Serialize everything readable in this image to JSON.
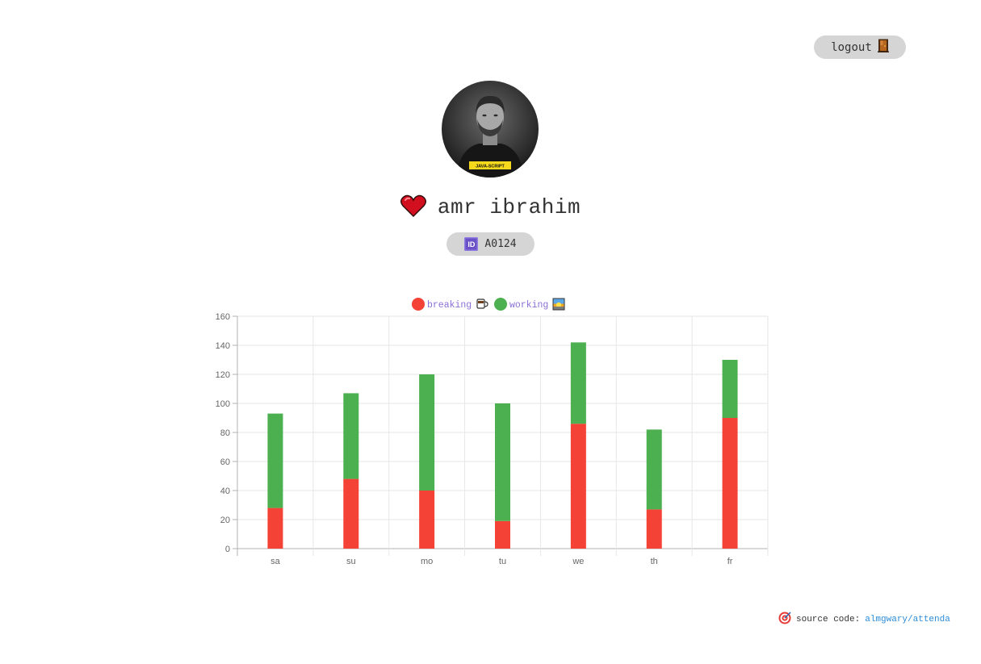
{
  "header": {
    "logout_label": "logout",
    "logout_icon": "door-icon"
  },
  "profile": {
    "name": "amr ibrahim",
    "heart_icon": "heart-icon",
    "id_badge_icon": "id-icon",
    "id_icon_text": "ID",
    "employee_id": "A0124",
    "avatar_shirt_text": "JAVA-SCRIPT"
  },
  "chart_data": {
    "type": "bar",
    "stacked": true,
    "categories": [
      "sa",
      "su",
      "mo",
      "tu",
      "we",
      "th",
      "fr"
    ],
    "series": [
      {
        "name": "breaking",
        "icon": "coffee-icon",
        "color": "#f44336",
        "values": [
          28,
          48,
          40,
          19,
          86,
          27,
          90
        ]
      },
      {
        "name": "working",
        "icon": "sunrise-icon",
        "color": "#4caf50",
        "values": [
          65,
          59,
          80,
          81,
          56,
          55,
          40
        ]
      }
    ],
    "ylim": [
      0,
      160
    ],
    "yticks": [
      0,
      20,
      40,
      60,
      80,
      100,
      120,
      140,
      160
    ],
    "grid": true,
    "legend_position": "top"
  },
  "footer": {
    "icon": "target-icon",
    "label": "source code:",
    "link_text": "almgwary/attenda"
  }
}
